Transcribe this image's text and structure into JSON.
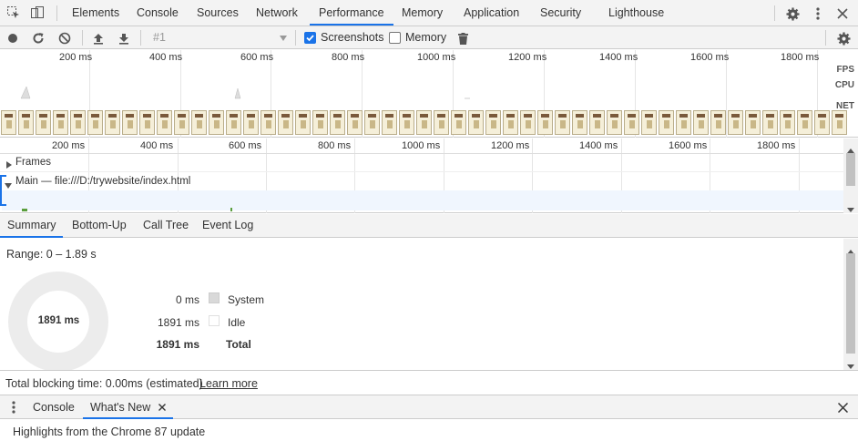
{
  "main_tabs": [
    {
      "label": "Elements"
    },
    {
      "label": "Console"
    },
    {
      "label": "Sources"
    },
    {
      "label": "Network"
    },
    {
      "label": "Performance",
      "active": true
    },
    {
      "label": "Memory"
    },
    {
      "label": "Application"
    },
    {
      "label": "Security"
    },
    {
      "label": "Lighthouse"
    }
  ],
  "toolbar": {
    "recording_select": "#1",
    "screenshots_label": "Screenshots",
    "screenshots_checked": true,
    "memory_label": "Memory",
    "memory_checked": false
  },
  "overview": {
    "ticks": [
      "200 ms",
      "400 ms",
      "600 ms",
      "800 ms",
      "1000 ms",
      "1200 ms",
      "1400 ms",
      "1600 ms",
      "1800 ms"
    ],
    "row_labels": {
      "fps": "FPS",
      "cpu": "CPU",
      "net": "NET"
    }
  },
  "timeline": {
    "ticks": [
      "200 ms",
      "400 ms",
      "600 ms",
      "800 ms",
      "1000 ms",
      "1200 ms",
      "1400 ms",
      "1600 ms",
      "1800 ms"
    ],
    "frames_label": "Frames",
    "main_label": "Main — file:///D:/trywebsite/index.html"
  },
  "summary_tabs": [
    {
      "label": "Summary",
      "active": true
    },
    {
      "label": "Bottom-Up"
    },
    {
      "label": "Call Tree"
    },
    {
      "label": "Event Log"
    }
  ],
  "summary": {
    "range": "Range: 0 – 1.89 s",
    "donut_center": "1891 ms",
    "rows": [
      {
        "value": "0 ms",
        "name": "System",
        "color": "#d9d9d9"
      },
      {
        "value": "1891 ms",
        "name": "Idle",
        "color": "#ffffff"
      },
      {
        "value": "1891 ms",
        "name": "Total",
        "bold": true
      }
    ]
  },
  "footnote": {
    "text": "Total blocking time: 0.00ms (estimated)",
    "link": "Learn more"
  },
  "drawer": {
    "tabs": [
      {
        "label": "Console"
      },
      {
        "label": "What's New",
        "active": true
      }
    ],
    "body": "Highlights from the Chrome 87 update"
  },
  "colors": {
    "accent": "#1a73e8"
  }
}
